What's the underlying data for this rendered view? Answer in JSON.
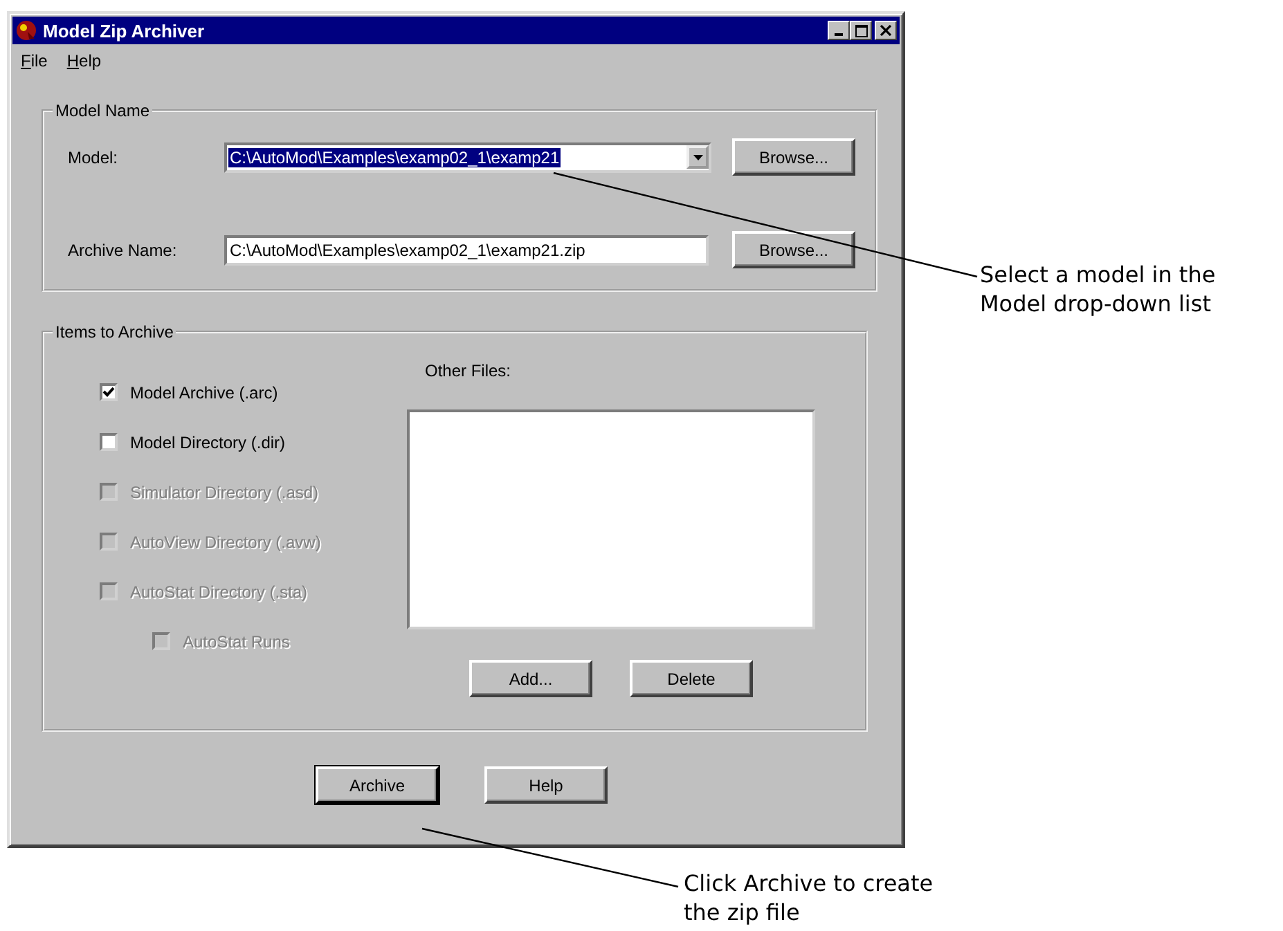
{
  "window": {
    "title": "Model Zip Archiver"
  },
  "menu": [
    {
      "label": "File"
    },
    {
      "label": "Help"
    }
  ],
  "model_name_group": {
    "title": "Model Name",
    "model": {
      "label": "Model:",
      "value": "C:\\AutoMod\\Examples\\examp02_1\\examp21",
      "text_selected": true,
      "button": "Browse..."
    },
    "archive_name": {
      "label": "Archive Name:",
      "value": "C:\\AutoMod\\Examples\\examp02_1\\examp21.zip",
      "button": "Browse..."
    }
  },
  "items_group": {
    "title": "Items to Archive",
    "checkboxes": [
      {
        "label": "Model Archive (.arc)",
        "checked": true,
        "disabled": false
      },
      {
        "label": "Model Directory (.dir)",
        "checked": false,
        "disabled": false
      },
      {
        "label": "Simulator Directory (.asd)",
        "checked": false,
        "disabled": true
      },
      {
        "label": "AutoView Directory (.avw)",
        "checked": false,
        "disabled": true
      },
      {
        "label": "AutoStat Directory (.sta)",
        "checked": false,
        "disabled": true,
        "children": [
          {
            "label": "AutoStat Runs",
            "checked": false,
            "disabled": true
          }
        ]
      }
    ],
    "other_files": {
      "label": "Other Files:",
      "buttons": [
        "Add...",
        "Delete"
      ]
    }
  },
  "footer_buttons": [
    {
      "label": "Archive",
      "default": true
    },
    {
      "label": "Help",
      "default": false
    }
  ],
  "callouts": [
    {
      "lines": [
        "Select a model in the",
        "Model drop-down list"
      ]
    },
    {
      "lines": [
        "Click Archive to create",
        "the zip file"
      ]
    }
  ]
}
